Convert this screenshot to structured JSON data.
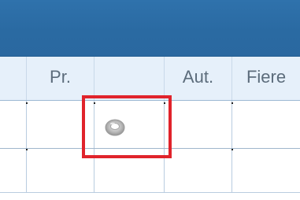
{
  "grid": {
    "columns": [
      {
        "key": "blank",
        "label": ""
      },
      {
        "key": "pr",
        "label": "Pr."
      },
      {
        "key": "status",
        "label": ""
      },
      {
        "key": "aut",
        "label": "Aut."
      },
      {
        "key": "fiere",
        "label": "Fiere"
      }
    ],
    "rows": [
      {
        "status_icon": "ring-status-icon"
      },
      {
        "status_icon": ""
      }
    ]
  },
  "highlight": {
    "target": "status-cell",
    "color": "#e0232b"
  },
  "colors": {
    "title_bar": "#2a6aa2",
    "header_bg": "#e6f0fa",
    "header_text": "#5c6c7b",
    "grid_line": "#b9cce0"
  }
}
